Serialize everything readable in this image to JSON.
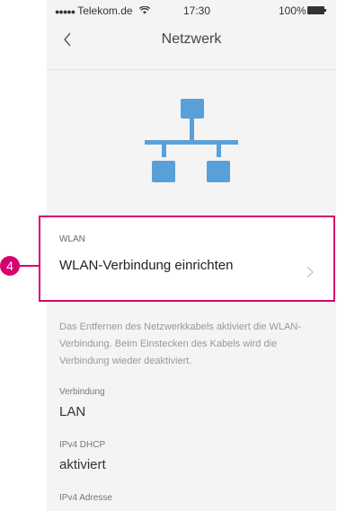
{
  "status_bar": {
    "signal_dots": "●●●●●",
    "carrier": "Telekom.de",
    "wifi_icon": "wifi-icon",
    "time": "17:30",
    "battery_percent": "100%"
  },
  "nav": {
    "back_icon": "chevron-left-icon",
    "title": "Netzwerk"
  },
  "hero_icon": "network-icon",
  "wlan": {
    "label": "WLAN",
    "value": "WLAN-Verbindung einrichten"
  },
  "callout": {
    "number": "4",
    "color": "#d7006e"
  },
  "info_text": "Das Entfernen des Netzwerkkabels aktiviert die WLAN-Verbindung. Beim Einstecken des Kabels wird die Verbindung wieder deaktiviert.",
  "fields": [
    {
      "label": "Verbindung",
      "value": "LAN"
    },
    {
      "label": "IPv4 DHCP",
      "value": "aktiviert"
    },
    {
      "label": "IPv4 Adresse",
      "value": ""
    }
  ],
  "colors": {
    "icon_blue": "#5aa0d8",
    "accent": "#d7006e"
  }
}
